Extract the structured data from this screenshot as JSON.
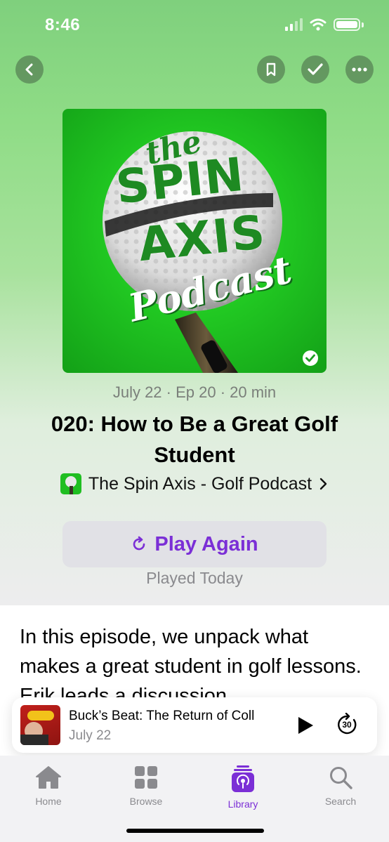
{
  "status_bar": {
    "time": "8:46"
  },
  "nav": {
    "back_icon": "chevron-left-icon",
    "bookmark_icon": "bookmark-icon",
    "played_icon": "checkmark-icon",
    "more_icon": "ellipsis-icon"
  },
  "artwork": {
    "line1": "the",
    "line2": "SPIN",
    "line3": "AXIS",
    "line4": "Podcast",
    "accent": "#21c822"
  },
  "episode": {
    "meta": "July 22 · Ep 20 · 20 min",
    "title": "020: How to Be a Great Golf Student",
    "show": "The Spin Axis - Golf Podcast",
    "play_label": "Play Again",
    "played_status": "Played Today",
    "description": "In this episode, we unpack what makes a great student in golf lessons. Erik leads a discussion"
  },
  "mini_player": {
    "title": "Buck’s Beat: The Return of Coll",
    "date": "July 22",
    "skip_label": "30"
  },
  "tabs": [
    {
      "label": "Home",
      "icon": "house-icon"
    },
    {
      "label": "Browse",
      "icon": "grid-icon"
    },
    {
      "label": "Library",
      "icon": "library-icon"
    },
    {
      "label": "Search",
      "icon": "search-icon"
    }
  ],
  "colors": {
    "accent": "#7b2fd6",
    "artwork_green": "#21c822"
  }
}
